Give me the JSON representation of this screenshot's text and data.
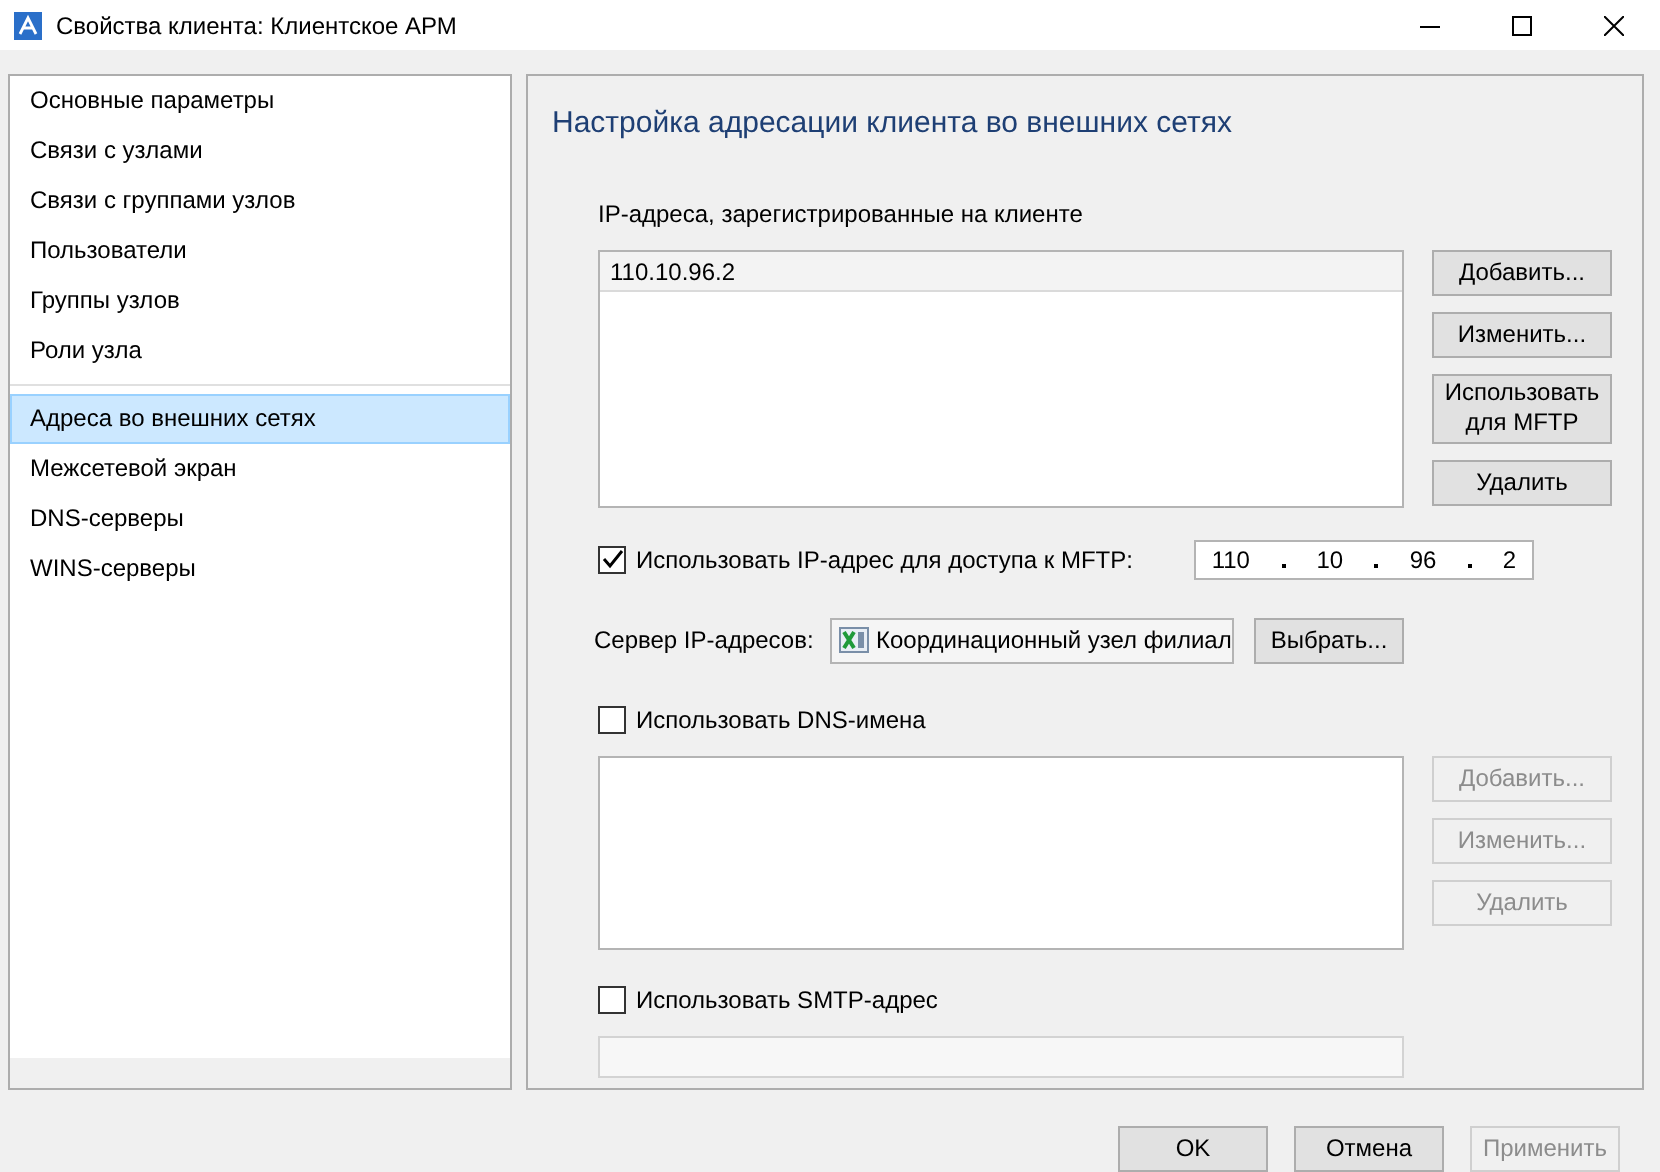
{
  "window": {
    "title": "Свойства клиента: Клиентское АРМ"
  },
  "sidebar": {
    "sections": [
      {
        "items": [
          {
            "label": "Основные параметры",
            "selected": false
          },
          {
            "label": "Связи с узлами",
            "selected": false
          },
          {
            "label": "Связи с группами узлов",
            "selected": false
          },
          {
            "label": "Пользователи",
            "selected": false
          },
          {
            "label": "Группы узлов",
            "selected": false
          },
          {
            "label": "Роли узла",
            "selected": false
          }
        ]
      },
      {
        "items": [
          {
            "label": "Адреса во внешних сетях",
            "selected": true
          },
          {
            "label": "Межсетевой экран",
            "selected": false
          },
          {
            "label": "DNS-серверы",
            "selected": false
          },
          {
            "label": "WINS-серверы",
            "selected": false
          }
        ]
      }
    ]
  },
  "panel": {
    "heading": "Настройка адресации клиента во внешних сетях",
    "ip_list": {
      "label": "IP-адреса, зарегистрированные на клиенте",
      "rows": [
        {
          "text": "110.10.96.2",
          "selected": true
        }
      ],
      "buttons": [
        {
          "label": "Добавить...",
          "disabled": false
        },
        {
          "label": "Изменить...",
          "disabled": false
        },
        {
          "label": "Использовать для MFTP",
          "disabled": false
        },
        {
          "label": "Удалить",
          "disabled": false
        }
      ]
    },
    "mftp": {
      "label": "Использовать IP-адрес для доступа к MFTP:",
      "checked": true,
      "octets": [
        "110",
        "10",
        "96",
        "2"
      ]
    },
    "server": {
      "label": "Сервер IP-адресов:",
      "value": "Координационный узел филиал",
      "button": "Выбрать..."
    },
    "dns": {
      "label": "Использовать DNS-имена",
      "checked": false,
      "buttons": [
        {
          "label": "Добавить...",
          "disabled": true
        },
        {
          "label": "Изменить...",
          "disabled": true
        },
        {
          "label": "Удалить",
          "disabled": true
        }
      ]
    },
    "smtp": {
      "label": "Использовать SMTP-адрес",
      "checked": false,
      "field_disabled": true
    }
  },
  "footer": {
    "buttons": [
      {
        "label": "OK",
        "disabled": false
      },
      {
        "label": "Отмена",
        "disabled": false
      },
      {
        "label": "Применить",
        "disabled": true
      }
    ]
  }
}
